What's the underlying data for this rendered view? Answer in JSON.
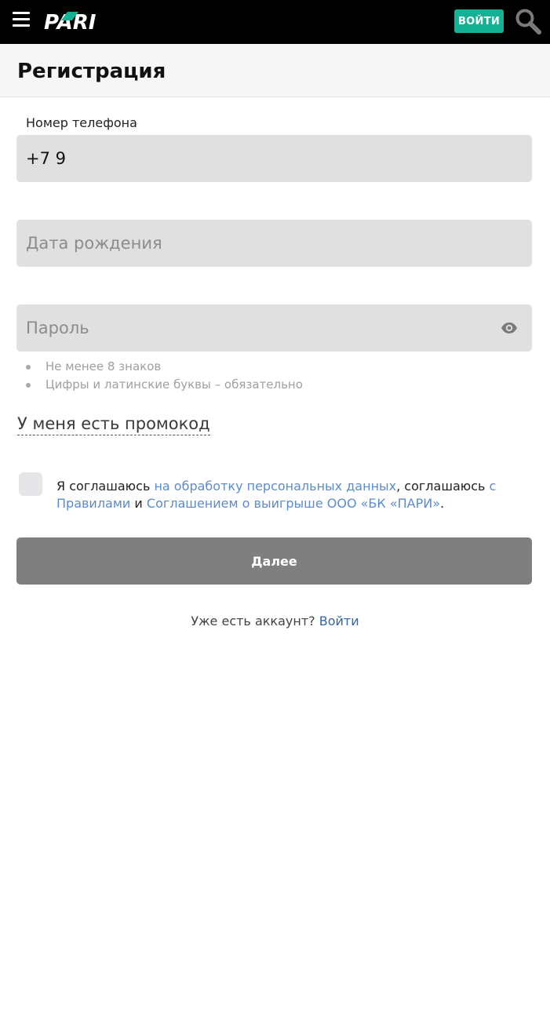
{
  "header": {
    "logo_text": "PARI",
    "login_label": "ВОЙТИ",
    "brand_color": "#14b294"
  },
  "page": {
    "title": "Регистрация"
  },
  "form": {
    "phone": {
      "label": "Номер телефона",
      "value": "+7 9"
    },
    "birthdate": {
      "placeholder": "Дата рождения"
    },
    "password": {
      "placeholder": "Пароль"
    },
    "password_hints": [
      "Не менее 8 знаков",
      "Цифры и латинские буквы – обязательно"
    ],
    "promo_label": "У меня есть промокод",
    "agreement": {
      "t1": "Я соглашаюсь ",
      "link1": "на обработку персональных данных",
      "t2": ", соглашаюсь ",
      "link2": "с Правилами",
      "t3": " и ",
      "link3": "Соглашением о выигрыше ООО «БК «ПАРИ»",
      "t4": "."
    },
    "next_label": "Далее"
  },
  "footer": {
    "have_account": "Уже есть аккаунт? ",
    "login_link": "Войти"
  }
}
